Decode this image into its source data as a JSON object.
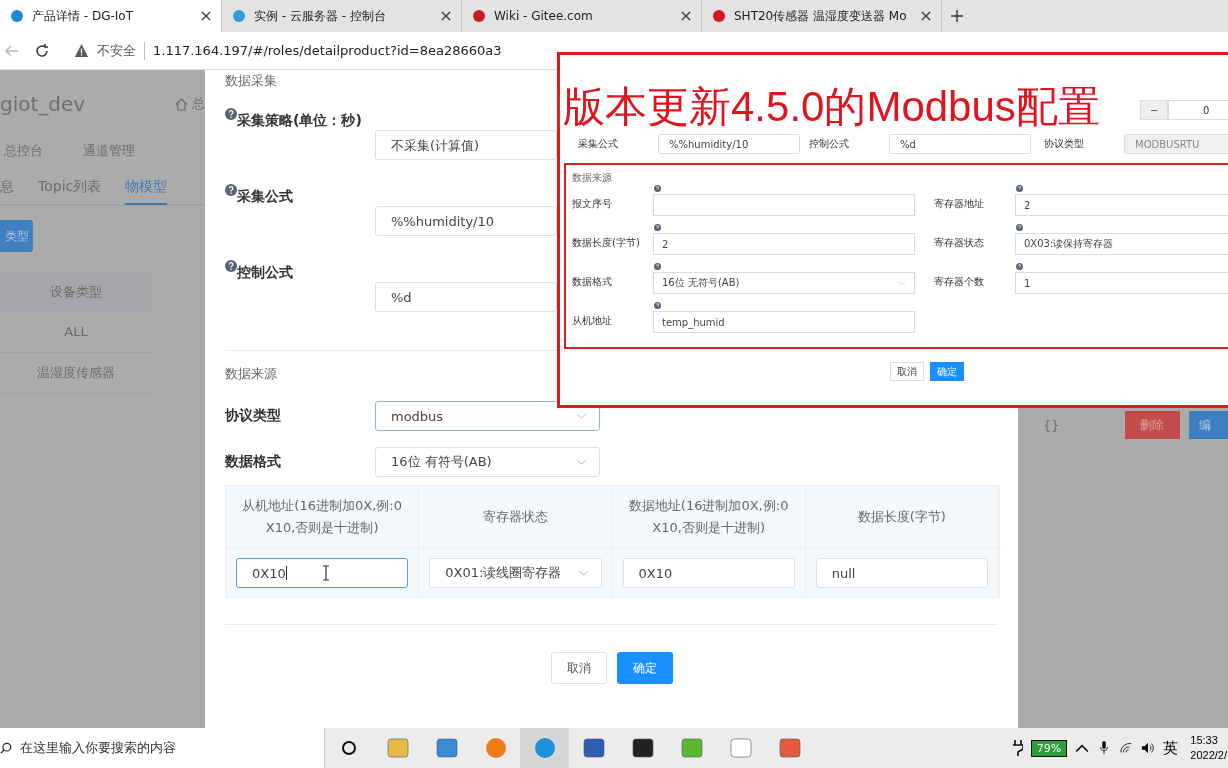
{
  "browser": {
    "tabs": [
      {
        "title": "产品详情 - DG-IoT",
        "selected": true
      },
      {
        "title": "实例 - 云服务器 - 控制台",
        "selected": false
      },
      {
        "title": "Wiki - Gitee.com",
        "selected": false
      },
      {
        "title": "SHT20传感器 温湿度变送器 Mo",
        "selected": false
      }
    ],
    "security": "不安全",
    "url": "1.117.164.197/#/roles/detailproduct?id=8ea28660a3"
  },
  "background_page": {
    "project": "giot_dev",
    "breadcrumb": "总",
    "nav": [
      "总控台",
      "通道管理"
    ],
    "tabs": [
      {
        "label": "息",
        "selected": false
      },
      {
        "label": "Topic列表",
        "selected": false
      },
      {
        "label": "物模型",
        "selected": true
      }
    ],
    "type_button": "类型",
    "table": {
      "column": "设备类型",
      "rows": [
        "ALL",
        "温湿度传感器"
      ]
    },
    "value": "{}",
    "delete_button": "删除",
    "edit_button": "编"
  },
  "dialog": {
    "collect_section": "数据采集",
    "fields": [
      {
        "label": "采集策略(单位：秒)",
        "value": "不采集(计算值)"
      },
      {
        "label": "采集公式",
        "value": "%%humidity/10"
      },
      {
        "label": "控制公式",
        "value": "%d"
      }
    ],
    "source_section": "数据来源",
    "selects": [
      {
        "label": "协议类型",
        "value": "modbus",
        "focused": true
      },
      {
        "label": "数据格式",
        "value": "16位 有符号(AB)",
        "focused": false
      }
    ],
    "table": {
      "columns": [
        "从机地址(16进制加0X,例:0X10,否则是十进制)",
        "寄存器状态",
        "数据地址(16进制加0X,例:0X10,否则是十进制)",
        "数据长度(字节)"
      ],
      "cells": [
        {
          "kind": "input",
          "value": "0X10",
          "focused": true
        },
        {
          "kind": "select",
          "value": "0X01:读线圈寄存器",
          "focused": false
        },
        {
          "kind": "input",
          "value": "0X10",
          "focused": false
        },
        {
          "kind": "input",
          "value": "null",
          "focused": false
        }
      ]
    },
    "cancel": "取消",
    "ok": "确定"
  },
  "inset": {
    "headline": "版本更新4.5.0的Modbus配置",
    "stepper": {
      "minus": "−",
      "value": "0"
    },
    "row": [
      {
        "label": "采集公式",
        "value": "%%humidity/10",
        "kind": "textarea"
      },
      {
        "label": "控制公式",
        "value": "%d",
        "kind": "textarea"
      },
      {
        "label": "协议类型",
        "value": "MODBUSRTU",
        "kind": "disabled"
      }
    ],
    "source_title": "数据来源",
    "fields": [
      {
        "label": "报文序号",
        "kind": "input"
      },
      {
        "label": "寄存器地址",
        "value": "2",
        "kind": "input"
      },
      {
        "label": "数据长度(字节)",
        "value": "2",
        "kind": "input"
      },
      {
        "label": "寄存器状态",
        "value": "0X03:读保持寄存器",
        "kind": "input"
      },
      {
        "label": "数据格式",
        "value": "16位 无符号(AB)",
        "kind": "select"
      },
      {
        "label": "寄存器个数",
        "value": "1",
        "kind": "input"
      },
      {
        "label": "从机地址",
        "value": "temp_humid",
        "kind": "input"
      }
    ],
    "cancel": "取消",
    "ok": "确定"
  },
  "taskbar": {
    "search_placeholder": "在这里输入你要搜索的内容",
    "battery": "79%",
    "ime": "英",
    "time": "15:33",
    "date": "2022/2/"
  }
}
